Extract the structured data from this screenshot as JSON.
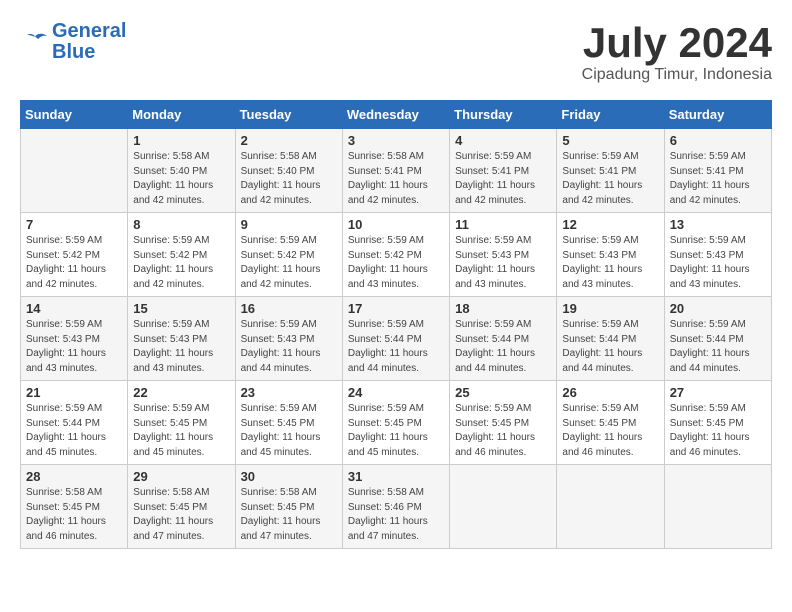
{
  "header": {
    "logo_line1": "General",
    "logo_line2": "Blue",
    "month_year": "July 2024",
    "location": "Cipadung Timur, Indonesia"
  },
  "columns": [
    "Sunday",
    "Monday",
    "Tuesday",
    "Wednesday",
    "Thursday",
    "Friday",
    "Saturday"
  ],
  "weeks": [
    [
      {
        "day": "",
        "detail": ""
      },
      {
        "day": "1",
        "detail": "Sunrise: 5:58 AM\nSunset: 5:40 PM\nDaylight: 11 hours\nand 42 minutes."
      },
      {
        "day": "2",
        "detail": "Sunrise: 5:58 AM\nSunset: 5:40 PM\nDaylight: 11 hours\nand 42 minutes."
      },
      {
        "day": "3",
        "detail": "Sunrise: 5:58 AM\nSunset: 5:41 PM\nDaylight: 11 hours\nand 42 minutes."
      },
      {
        "day": "4",
        "detail": "Sunrise: 5:59 AM\nSunset: 5:41 PM\nDaylight: 11 hours\nand 42 minutes."
      },
      {
        "day": "5",
        "detail": "Sunrise: 5:59 AM\nSunset: 5:41 PM\nDaylight: 11 hours\nand 42 minutes."
      },
      {
        "day": "6",
        "detail": "Sunrise: 5:59 AM\nSunset: 5:41 PM\nDaylight: 11 hours\nand 42 minutes."
      }
    ],
    [
      {
        "day": "7",
        "detail": "Sunrise: 5:59 AM\nSunset: 5:42 PM\nDaylight: 11 hours\nand 42 minutes."
      },
      {
        "day": "8",
        "detail": "Sunrise: 5:59 AM\nSunset: 5:42 PM\nDaylight: 11 hours\nand 42 minutes."
      },
      {
        "day": "9",
        "detail": "Sunrise: 5:59 AM\nSunset: 5:42 PM\nDaylight: 11 hours\nand 42 minutes."
      },
      {
        "day": "10",
        "detail": "Sunrise: 5:59 AM\nSunset: 5:42 PM\nDaylight: 11 hours\nand 43 minutes."
      },
      {
        "day": "11",
        "detail": "Sunrise: 5:59 AM\nSunset: 5:43 PM\nDaylight: 11 hours\nand 43 minutes."
      },
      {
        "day": "12",
        "detail": "Sunrise: 5:59 AM\nSunset: 5:43 PM\nDaylight: 11 hours\nand 43 minutes."
      },
      {
        "day": "13",
        "detail": "Sunrise: 5:59 AM\nSunset: 5:43 PM\nDaylight: 11 hours\nand 43 minutes."
      }
    ],
    [
      {
        "day": "14",
        "detail": "Sunrise: 5:59 AM\nSunset: 5:43 PM\nDaylight: 11 hours\nand 43 minutes."
      },
      {
        "day": "15",
        "detail": "Sunrise: 5:59 AM\nSunset: 5:43 PM\nDaylight: 11 hours\nand 43 minutes."
      },
      {
        "day": "16",
        "detail": "Sunrise: 5:59 AM\nSunset: 5:43 PM\nDaylight: 11 hours\nand 44 minutes."
      },
      {
        "day": "17",
        "detail": "Sunrise: 5:59 AM\nSunset: 5:44 PM\nDaylight: 11 hours\nand 44 minutes."
      },
      {
        "day": "18",
        "detail": "Sunrise: 5:59 AM\nSunset: 5:44 PM\nDaylight: 11 hours\nand 44 minutes."
      },
      {
        "day": "19",
        "detail": "Sunrise: 5:59 AM\nSunset: 5:44 PM\nDaylight: 11 hours\nand 44 minutes."
      },
      {
        "day": "20",
        "detail": "Sunrise: 5:59 AM\nSunset: 5:44 PM\nDaylight: 11 hours\nand 44 minutes."
      }
    ],
    [
      {
        "day": "21",
        "detail": "Sunrise: 5:59 AM\nSunset: 5:44 PM\nDaylight: 11 hours\nand 45 minutes."
      },
      {
        "day": "22",
        "detail": "Sunrise: 5:59 AM\nSunset: 5:45 PM\nDaylight: 11 hours\nand 45 minutes."
      },
      {
        "day": "23",
        "detail": "Sunrise: 5:59 AM\nSunset: 5:45 PM\nDaylight: 11 hours\nand 45 minutes."
      },
      {
        "day": "24",
        "detail": "Sunrise: 5:59 AM\nSunset: 5:45 PM\nDaylight: 11 hours\nand 45 minutes."
      },
      {
        "day": "25",
        "detail": "Sunrise: 5:59 AM\nSunset: 5:45 PM\nDaylight: 11 hours\nand 46 minutes."
      },
      {
        "day": "26",
        "detail": "Sunrise: 5:59 AM\nSunset: 5:45 PM\nDaylight: 11 hours\nand 46 minutes."
      },
      {
        "day": "27",
        "detail": "Sunrise: 5:59 AM\nSunset: 5:45 PM\nDaylight: 11 hours\nand 46 minutes."
      }
    ],
    [
      {
        "day": "28",
        "detail": "Sunrise: 5:58 AM\nSunset: 5:45 PM\nDaylight: 11 hours\nand 46 minutes."
      },
      {
        "day": "29",
        "detail": "Sunrise: 5:58 AM\nSunset: 5:45 PM\nDaylight: 11 hours\nand 47 minutes."
      },
      {
        "day": "30",
        "detail": "Sunrise: 5:58 AM\nSunset: 5:45 PM\nDaylight: 11 hours\nand 47 minutes."
      },
      {
        "day": "31",
        "detail": "Sunrise: 5:58 AM\nSunset: 5:46 PM\nDaylight: 11 hours\nand 47 minutes."
      },
      {
        "day": "",
        "detail": ""
      },
      {
        "day": "",
        "detail": ""
      },
      {
        "day": "",
        "detail": ""
      }
    ]
  ]
}
